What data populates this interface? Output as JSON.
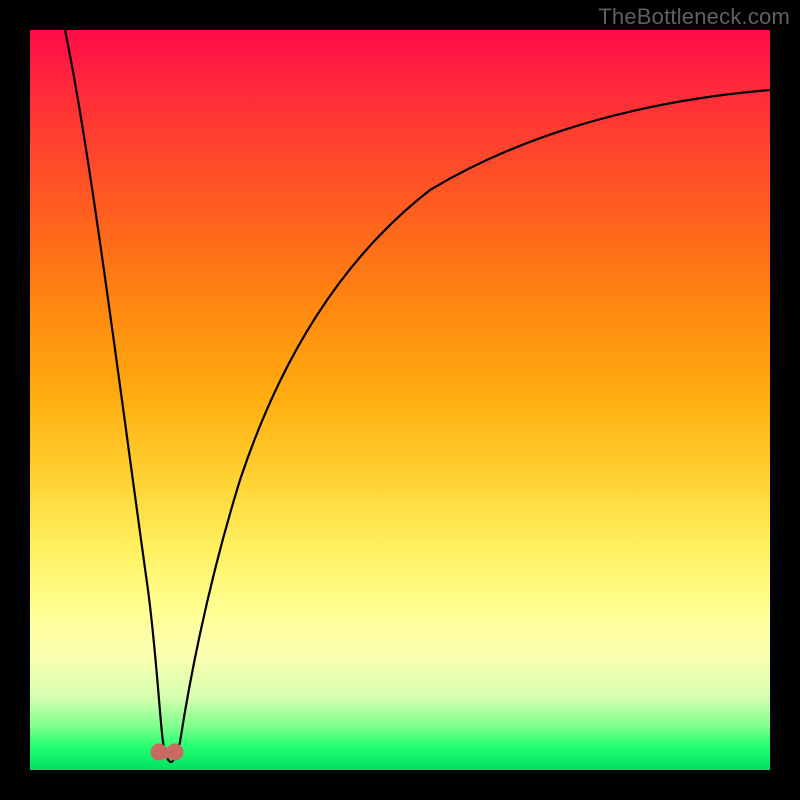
{
  "watermark": "TheBottleneck.com",
  "chart_data": {
    "type": "line",
    "title": "",
    "xlabel": "",
    "ylabel": "",
    "xlim": [
      0,
      100
    ],
    "ylim": [
      0,
      100
    ],
    "grid": false,
    "legend": false,
    "annotations": [],
    "series": [
      {
        "name": "curve",
        "x": [
          0,
          2,
          4,
          6,
          8,
          10,
          12,
          14,
          16,
          17,
          18,
          19,
          20,
          22,
          24,
          26,
          28,
          30,
          34,
          38,
          42,
          46,
          50,
          56,
          62,
          70,
          80,
          90,
          100
        ],
        "y": [
          100,
          90,
          80,
          70,
          59,
          48,
          36,
          24,
          12,
          5,
          1,
          1,
          5,
          15,
          25,
          33,
          40,
          46,
          55,
          62,
          67,
          71,
          74,
          78,
          81,
          84,
          86,
          88,
          89
        ]
      }
    ],
    "markers": [
      {
        "name": "well-left",
        "x": 17.3,
        "y": 2.3
      },
      {
        "name": "well-right",
        "x": 19.4,
        "y": 2.3
      }
    ],
    "colors": {
      "curve": "#000000",
      "marker": "#c96a60",
      "gradient_top": "#ff0a4a",
      "gradient_bottom": "#00e060"
    }
  }
}
